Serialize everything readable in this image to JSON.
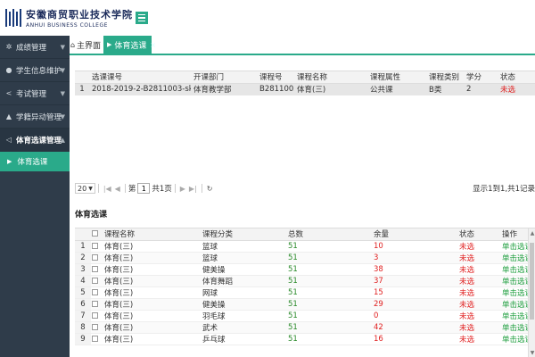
{
  "header": {
    "logo_cn": "安徽商贸职业技术学院",
    "logo_en": "ANHUI BUSINESS COLLEGE"
  },
  "sidebar": {
    "items": [
      {
        "label": "成绩管理",
        "icon": "gear-icon"
      },
      {
        "label": "学生信息维护",
        "icon": "user-icon"
      },
      {
        "label": "考试管理",
        "icon": "share-icon"
      },
      {
        "label": "学籍异动管理",
        "icon": "graduation-cap-icon"
      },
      {
        "label": "体育选课管理",
        "icon": "send-icon"
      }
    ],
    "sub_item": "体育选课"
  },
  "tabs": {
    "home": "主界面",
    "active": "体育选课",
    "close": "×"
  },
  "selected_grid": {
    "columns": [
      "选课课号",
      "开课部门",
      "课程号",
      "课程名称",
      "课程属性",
      "课程类别",
      "学分",
      "状态"
    ],
    "rows": [
      {
        "no": "1",
        "code": "2018-2019-2-B2811003-skjszgh-01",
        "dept": "体育教学部",
        "course_no": "B2811003",
        "name": "体育(三)",
        "attr": "公共课",
        "category": "B类",
        "credit": "2",
        "status": "未选"
      }
    ]
  },
  "pager": {
    "page_size": "20",
    "page_prefix": "第",
    "page_value": "1",
    "page_total": "共1页",
    "refresh": "↻",
    "info": "显示1到1,共1记录"
  },
  "section_title": "体育选课",
  "course_grid": {
    "columns": [
      "课程名称",
      "课程分类",
      "总数",
      "余量",
      "状态",
      "操作"
    ],
    "rows": [
      {
        "no": "1",
        "name": "体育(三)",
        "type": "篮球",
        "total": "51",
        "remain": "10",
        "status": "未选",
        "action": "单击选课"
      },
      {
        "no": "2",
        "name": "体育(三)",
        "type": "篮球",
        "total": "51",
        "remain": "3",
        "status": "未选",
        "action": "单击选课"
      },
      {
        "no": "3",
        "name": "体育(三)",
        "type": "健美操",
        "total": "51",
        "remain": "38",
        "status": "未选",
        "action": "单击选课"
      },
      {
        "no": "4",
        "name": "体育(三)",
        "type": "体育舞蹈",
        "total": "51",
        "remain": "37",
        "status": "未选",
        "action": "单击选课"
      },
      {
        "no": "5",
        "name": "体育(三)",
        "type": "网球",
        "total": "51",
        "remain": "15",
        "status": "未选",
        "action": "单击选课"
      },
      {
        "no": "6",
        "name": "体育(三)",
        "type": "健美操",
        "total": "51",
        "remain": "29",
        "status": "未选",
        "action": "单击选课"
      },
      {
        "no": "7",
        "name": "体育(三)",
        "type": "羽毛球",
        "total": "51",
        "remain": "0",
        "status": "未选",
        "action": "单击选课"
      },
      {
        "no": "8",
        "name": "体育(三)",
        "type": "武术",
        "total": "51",
        "remain": "42",
        "status": "未选",
        "action": "单击选课"
      },
      {
        "no": "9",
        "name": "体育(三)",
        "type": "乒乓球",
        "total": "51",
        "remain": "16",
        "status": "未选",
        "action": "单击选课"
      }
    ]
  },
  "colors": {
    "accent": "#2aaa8a",
    "sidebar": "#2f3c4a",
    "status_red": "#e02020",
    "action_green": "#1e9e3e"
  }
}
